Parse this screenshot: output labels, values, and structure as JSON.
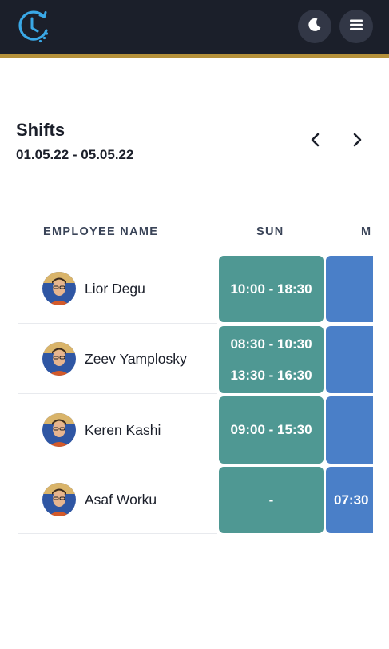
{
  "colors": {
    "topbar": "#1b1f2a",
    "accent_stripe": "#b5913a",
    "logo": "#3aa8e6",
    "sun_cell": "#4f9893",
    "mon_cell": "#4a7fc8"
  },
  "header": {
    "logo_icon": "clock-icon",
    "theme_icon": "moon-icon",
    "menu_icon": "hamburger-menu-icon"
  },
  "page": {
    "title": "Shifts",
    "date_range": "01.05.22 - 05.05.22",
    "prev_icon": "chevron-left-icon",
    "next_icon": "chevron-right-icon"
  },
  "table": {
    "columns": {
      "name": "EMPLOYEE NAME",
      "sun": "SUN",
      "mon": "M"
    },
    "rows": [
      {
        "name": "Lior Degu",
        "sun": [
          "10:00 - 18:30"
        ],
        "mon": ""
      },
      {
        "name": "Zeev Yamplosky",
        "sun": [
          "08:30 - 10:30",
          "13:30 - 16:30"
        ],
        "mon": ""
      },
      {
        "name": "Keren Kashi",
        "sun": [
          "09:00 - 15:30"
        ],
        "mon": ""
      },
      {
        "name": "Asaf Worku",
        "sun": [
          "-"
        ],
        "mon": "07:30"
      }
    ]
  }
}
